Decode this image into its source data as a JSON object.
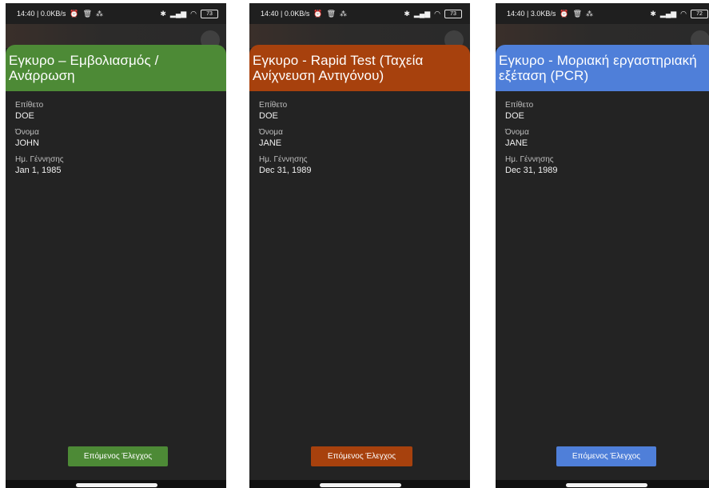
{
  "screens": [
    {
      "status": {
        "time_speed": "14:40 | 0.0KB/s",
        "left_icons": [
          "alarm-icon",
          "trash-icon",
          "signal-icon"
        ],
        "right_icons": [
          "bluetooth-icon",
          "signal-bars-icon",
          "wifi-icon"
        ],
        "battery": "73"
      },
      "header_title": "Εγκυρο – Εμβολιασμός / Ανάρρωση",
      "header_color": "#4d8a36",
      "fields": [
        {
          "label": "Επίθετο",
          "value": "DOE"
        },
        {
          "label": "Όνομα",
          "value": "JOHN"
        },
        {
          "label": "Ημ. Γέννησης",
          "value": "Jan 1, 1985"
        }
      ],
      "button_label": "Επόμενος Έλεγχος",
      "button_color": "#4d8a36"
    },
    {
      "status": {
        "time_speed": "14:40 | 0.0KB/s",
        "left_icons": [
          "alarm-icon",
          "trash-icon",
          "signal-icon"
        ],
        "right_icons": [
          "bluetooth-icon",
          "signal-bars-icon",
          "wifi-icon"
        ],
        "battery": "73"
      },
      "header_title": "Εγκυρο - Rapid Test (Ταχεία Ανίχνευση Αντιγόνου)",
      "header_color": "#a7410d",
      "fields": [
        {
          "label": "Επίθετο",
          "value": "DOE"
        },
        {
          "label": "Όνομα",
          "value": "JANE"
        },
        {
          "label": "Ημ. Γέννησης",
          "value": "Dec 31, 1989"
        }
      ],
      "button_label": "Επόμενος Έλεγχος",
      "button_color": "#a7410d"
    },
    {
      "status": {
        "time_speed": "14:40 | 3.0KB/s",
        "left_icons": [
          "alarm-icon",
          "trash-icon",
          "signal-icon"
        ],
        "right_icons": [
          "bluetooth-icon",
          "signal-bars-icon",
          "wifi-icon"
        ],
        "battery": "72"
      },
      "header_title": "Εγκυρο - Μοριακή εργαστηριακή εξέταση (PCR)",
      "header_color": "#4f7fd9",
      "fields": [
        {
          "label": "Επίθετο",
          "value": "DOE"
        },
        {
          "label": "Όνομα",
          "value": "JANE"
        },
        {
          "label": "Ημ. Γέννησης",
          "value": "Dec 31, 1989"
        }
      ],
      "button_label": "Επόμενος Έλεγχος",
      "button_color": "#4f7fd9"
    }
  ]
}
